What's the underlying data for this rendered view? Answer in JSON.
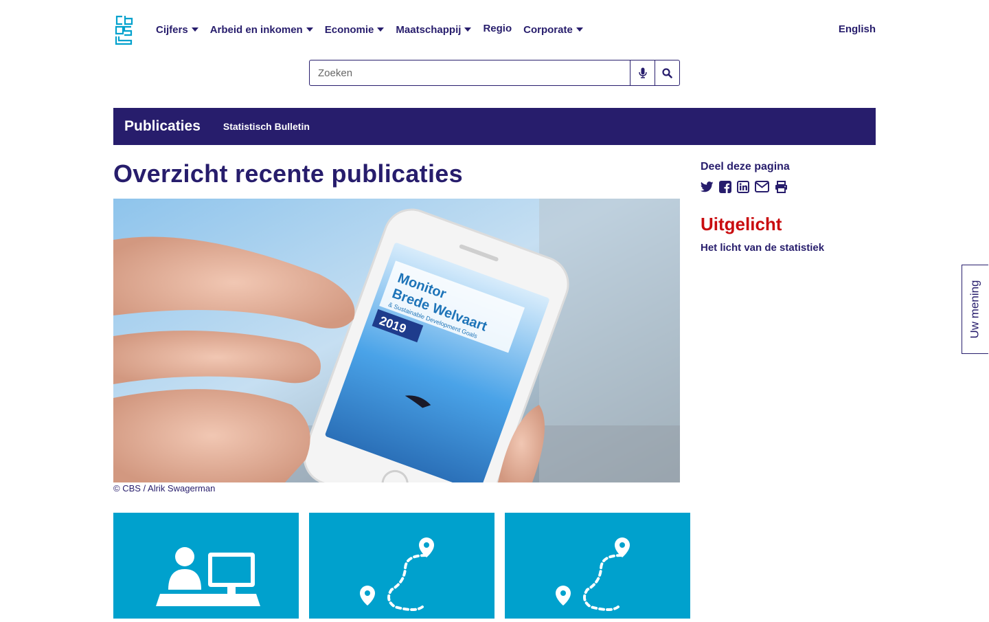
{
  "header": {
    "logo_icon": "cbs-logo-icon",
    "nav": [
      {
        "label": "Cijfers",
        "dropdown": true
      },
      {
        "label": "Arbeid en inkomen",
        "dropdown": true
      },
      {
        "label": "Economie",
        "dropdown": true
      },
      {
        "label": "Maatschappij",
        "dropdown": true
      },
      {
        "label": "Regio",
        "dropdown": false
      },
      {
        "label": "Corporate",
        "dropdown": true
      }
    ],
    "language_link": "English"
  },
  "search": {
    "placeholder": "Zoeken",
    "voice_icon": "microphone-icon",
    "search_icon": "search-icon"
  },
  "section_bar": {
    "title": "Publicaties",
    "link": "Statistisch Bulletin"
  },
  "main": {
    "title": "Overzicht recente publicaties",
    "hero_phone_text": [
      "Monitor",
      "Brede Welvaart",
      "& Sustainable Development Goals",
      "2019"
    ],
    "hero_caption": "© CBS / Alrik Swagerman",
    "tiles": [
      {
        "icon": "person-at-computer-icon"
      },
      {
        "icon": "route-map-icon"
      },
      {
        "icon": "route-map-icon"
      }
    ]
  },
  "sidebar": {
    "share_title": "Deel deze pagina",
    "share_icons": [
      "twitter-icon",
      "facebook-icon",
      "linkedin-icon",
      "email-icon",
      "print-icon"
    ],
    "featured_title": "Uitgelicht",
    "featured_link": "Het licht van de statistiek"
  },
  "feedback_tab": "Uw mening",
  "colors": {
    "brand_navy": "#271d6c",
    "accent_red": "#c90c0f",
    "tile_blue": "#00a1cd"
  }
}
